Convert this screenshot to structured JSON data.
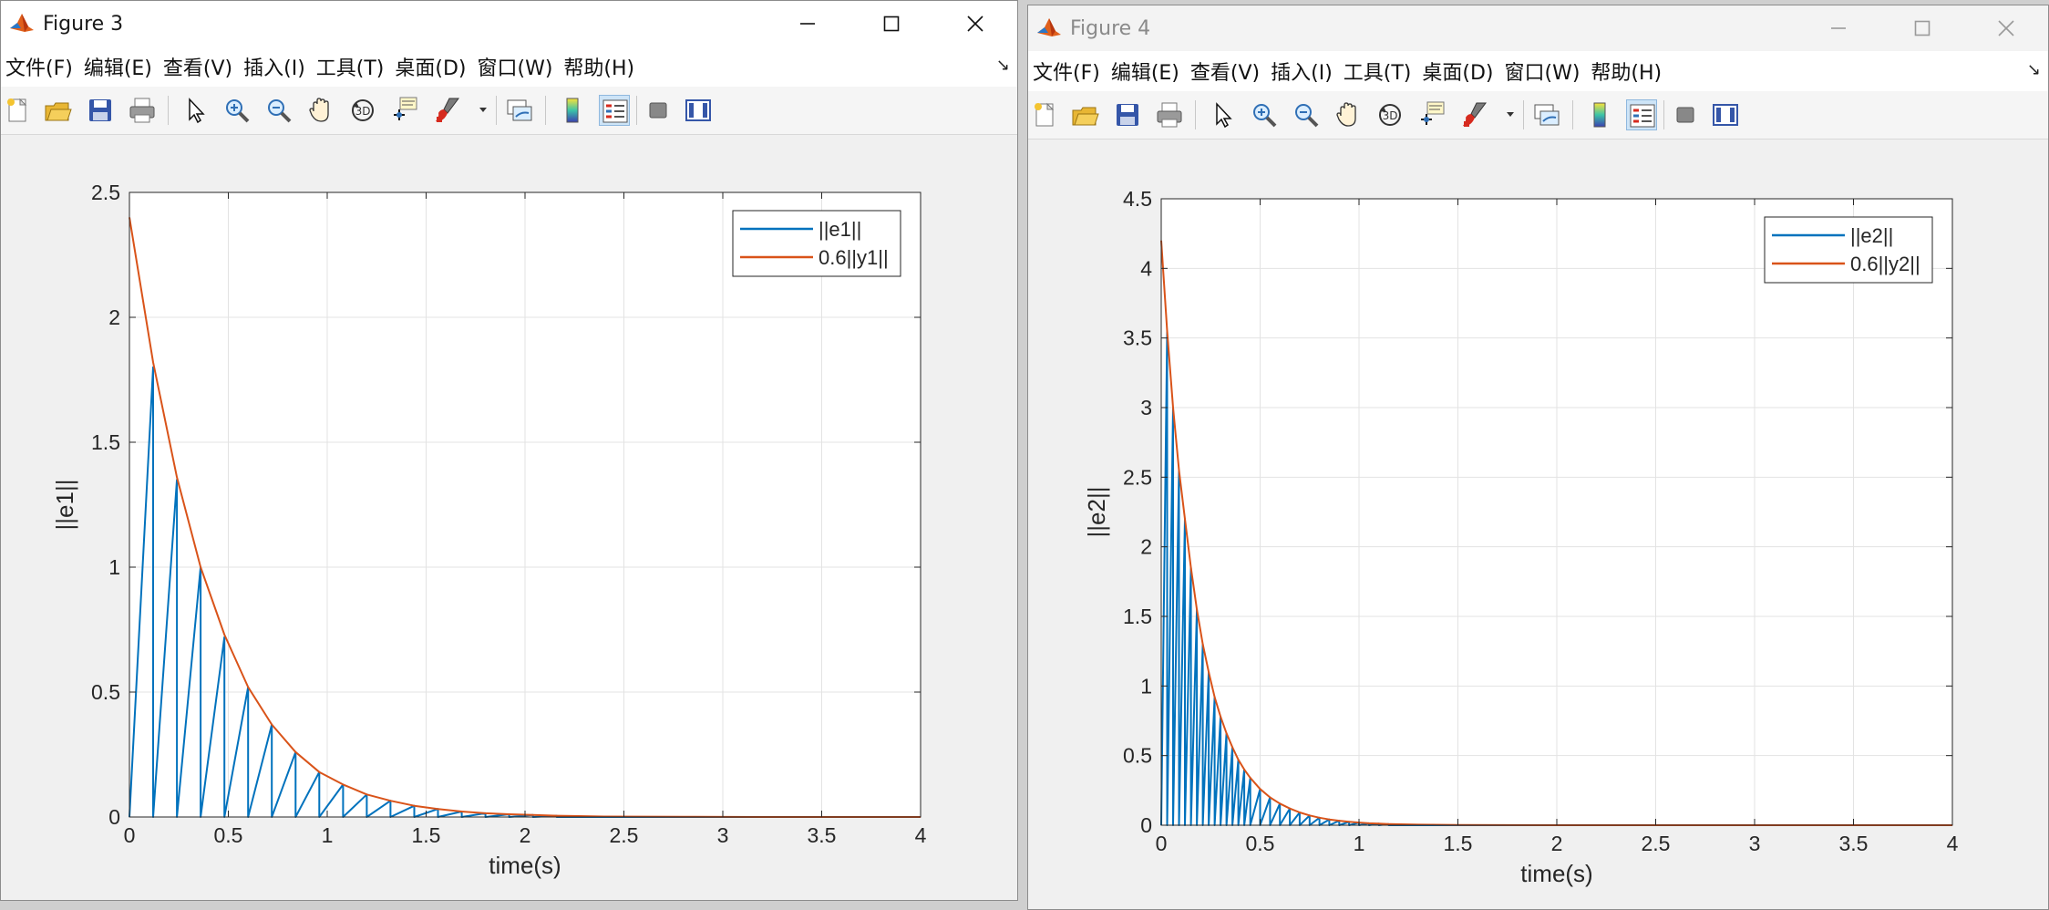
{
  "windows": [
    {
      "title": "Figure 3",
      "menus": [
        "文件(F)",
        "编辑(E)",
        "查看(V)",
        "插入(I)",
        "工具(T)",
        "桌面(D)",
        "窗口(W)",
        "帮助(H)"
      ],
      "toolbar_icons": [
        "new-figure-icon",
        "open-file-icon",
        "save-icon",
        "print-icon",
        "select-arrow-icon",
        "zoom-in-icon",
        "zoom-out-icon",
        "pan-hand-icon",
        "rotate-3d-icon",
        "data-cursor-icon",
        "brush-icon",
        "brush-dropdown-icon",
        "link-plot-icon",
        "colorbar-icon",
        "legend-icon",
        "hide-plot-tools-icon",
        "show-plot-tools-icon"
      ]
    },
    {
      "title": "Figure 4",
      "menus": [
        "文件(F)",
        "编辑(E)",
        "查看(V)",
        "插入(I)",
        "工具(T)",
        "桌面(D)",
        "窗口(W)",
        "帮助(H)"
      ],
      "toolbar_icons": [
        "new-figure-icon",
        "open-file-icon",
        "save-icon",
        "print-icon",
        "select-arrow-icon",
        "zoom-in-icon",
        "zoom-out-icon",
        "pan-hand-icon",
        "rotate-3d-icon",
        "data-cursor-icon",
        "brush-icon",
        "brush-dropdown-icon",
        "link-plot-icon",
        "colorbar-icon",
        "legend-icon",
        "hide-plot-tools-icon",
        "show-plot-tools-icon"
      ]
    }
  ],
  "colors": {
    "series_blue": "#0072BD",
    "series_orange": "#D95319",
    "grid": "#e3e3e3"
  },
  "chart_data": [
    {
      "type": "line",
      "title": "",
      "xlabel": "time(s)",
      "ylabel": "||e1||",
      "xlim": [
        0,
        4
      ],
      "ylim": [
        0,
        2.5
      ],
      "xticks": [
        0,
        0.5,
        1,
        1.5,
        2,
        2.5,
        3,
        3.5,
        4
      ],
      "yticks": [
        0,
        0.5,
        1,
        1.5,
        2,
        2.5
      ],
      "grid": true,
      "legend_position": "top-right",
      "series": [
        {
          "name": "||e1||",
          "color": "#0072BD",
          "x": [
            0,
            0.12,
            0.12,
            0.24,
            0.24,
            0.36,
            0.36,
            0.48,
            0.48,
            0.6,
            0.6,
            0.72,
            0.72,
            0.84,
            0.84,
            0.96,
            0.96,
            1.08,
            1.08,
            1.2,
            1.2,
            1.32,
            1.32,
            1.44,
            1.44,
            1.56,
            1.56,
            1.68,
            1.68,
            1.8,
            1.8,
            1.92,
            1.92,
            2.04,
            2.04,
            2.16,
            2.16,
            4
          ],
          "y": [
            0,
            1.8,
            0,
            1.35,
            0,
            1.0,
            0,
            0.72,
            0,
            0.52,
            0,
            0.37,
            0,
            0.26,
            0,
            0.18,
            0,
            0.13,
            0,
            0.09,
            0,
            0.065,
            0,
            0.045,
            0,
            0.032,
            0,
            0.022,
            0,
            0.015,
            0,
            0.011,
            0,
            0.008,
            0,
            0.005,
            0,
            0
          ]
        },
        {
          "name": "0.6||y1||",
          "color": "#D95319",
          "x": [
            0,
            0.12,
            0.24,
            0.36,
            0.48,
            0.6,
            0.72,
            0.84,
            0.96,
            1.08,
            1.2,
            1.32,
            1.44,
            1.56,
            1.68,
            1.8,
            1.92,
            2.04,
            2.16,
            2.4,
            2.8,
            3.2,
            3.6,
            4
          ],
          "y": [
            2.4,
            1.82,
            1.36,
            1.0,
            0.73,
            0.52,
            0.37,
            0.26,
            0.18,
            0.13,
            0.09,
            0.065,
            0.045,
            0.032,
            0.022,
            0.015,
            0.011,
            0.008,
            0.005,
            0.002,
            0.001,
            0,
            0,
            0
          ]
        }
      ]
    },
    {
      "type": "line",
      "title": "",
      "xlabel": "time(s)",
      "ylabel": "||e2||",
      "xlim": [
        0,
        4
      ],
      "ylim": [
        0,
        4.5
      ],
      "xticks": [
        0,
        0.5,
        1,
        1.5,
        2,
        2.5,
        3,
        3.5,
        4
      ],
      "yticks": [
        0,
        0.5,
        1,
        1.5,
        2,
        2.5,
        3,
        3.5,
        4,
        4.5
      ],
      "grid": true,
      "legend_position": "top-right",
      "series": [
        {
          "name": "||e2||",
          "color": "#0072BD",
          "x": [
            0,
            0.03,
            0.03,
            0.06,
            0.06,
            0.09,
            0.09,
            0.12,
            0.12,
            0.15,
            0.15,
            0.18,
            0.18,
            0.21,
            0.21,
            0.24,
            0.24,
            0.27,
            0.27,
            0.3,
            0.3,
            0.33,
            0.33,
            0.36,
            0.36,
            0.39,
            0.39,
            0.42,
            0.42,
            0.45,
            0.45,
            0.5,
            0.5,
            0.55,
            0.55,
            0.6,
            0.6,
            0.65,
            0.65,
            0.7,
            0.7,
            0.75,
            0.75,
            0.8,
            0.8,
            0.85,
            0.85,
            0.9,
            0.9,
            0.95,
            0.95,
            1.0,
            1.0,
            1.05,
            1.05,
            1.1,
            1.1,
            1.15,
            1.15,
            4
          ],
          "y": [
            0,
            3.55,
            0,
            3.0,
            0,
            2.55,
            0,
            2.2,
            0,
            1.85,
            0,
            1.55,
            0,
            1.3,
            0,
            1.1,
            0,
            0.92,
            0,
            0.78,
            0,
            0.66,
            0,
            0.56,
            0,
            0.47,
            0,
            0.4,
            0,
            0.34,
            0,
            0.26,
            0,
            0.2,
            0,
            0.155,
            0,
            0.12,
            0,
            0.092,
            0,
            0.07,
            0,
            0.054,
            0,
            0.041,
            0,
            0.032,
            0,
            0.024,
            0,
            0.019,
            0,
            0.014,
            0,
            0.011,
            0,
            0.008,
            0,
            0
          ]
        },
        {
          "name": "0.6||y2||",
          "color": "#D95319",
          "x": [
            0,
            0.03,
            0.06,
            0.09,
            0.12,
            0.15,
            0.18,
            0.21,
            0.24,
            0.27,
            0.3,
            0.33,
            0.36,
            0.39,
            0.42,
            0.45,
            0.5,
            0.55,
            0.6,
            0.65,
            0.7,
            0.75,
            0.8,
            0.85,
            0.9,
            0.95,
            1.0,
            1.05,
            1.1,
            1.15,
            1.3,
            1.5,
            2.0,
            3.0,
            4.0
          ],
          "y": [
            4.2,
            3.55,
            3.0,
            2.55,
            2.2,
            1.85,
            1.55,
            1.3,
            1.1,
            0.92,
            0.78,
            0.66,
            0.56,
            0.47,
            0.4,
            0.34,
            0.26,
            0.2,
            0.155,
            0.12,
            0.092,
            0.07,
            0.054,
            0.041,
            0.032,
            0.024,
            0.019,
            0.014,
            0.011,
            0.008,
            0.004,
            0.001,
            0,
            0,
            0
          ]
        }
      ]
    }
  ]
}
